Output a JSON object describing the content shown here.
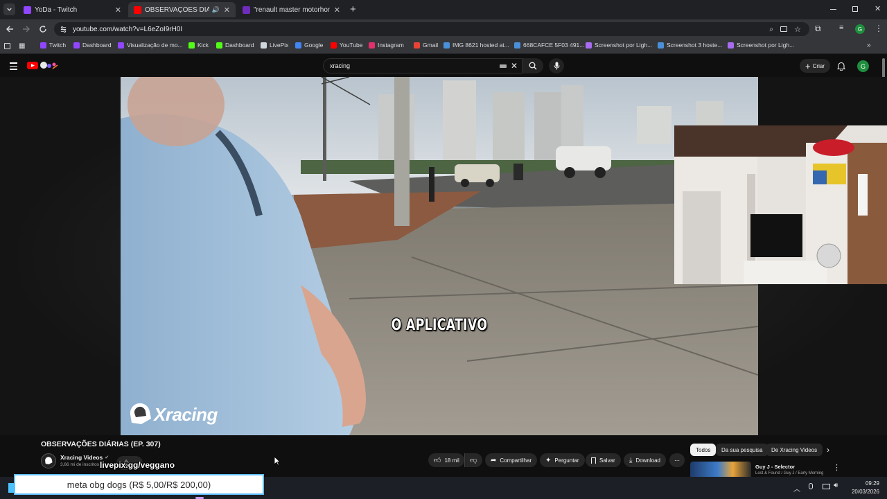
{
  "browser": {
    "tabs": [
      {
        "title": "YoDa - Twitch",
        "active": false,
        "favicon_color": "#9146ff"
      },
      {
        "title": "OBSERVAÇÕES DIÁRIAS (EP.",
        "active": true,
        "favicon_color": "#ff0000"
      },
      {
        "title": "\"renault master motorhome\" -",
        "active": false,
        "favicon_color": "#6f2dbd"
      }
    ],
    "new_tab_symbol": "+",
    "url": "youtube.com/watch?v=L6eZoI9rH0I",
    "bookmarks": [
      {
        "label": "Twitch",
        "color": "#9146ff"
      },
      {
        "label": "Dashboard",
        "color": "#9146ff"
      },
      {
        "label": "Visualização de mo...",
        "color": "#9146ff"
      },
      {
        "label": "Kick",
        "color": "#53fc18"
      },
      {
        "label": "Dashboard",
        "color": "#53fc18"
      },
      {
        "label": "LivePix",
        "color": "#cfd8dc"
      },
      {
        "label": "Google",
        "color": "#4285f4"
      },
      {
        "label": "YouTube",
        "color": "#ff0000"
      },
      {
        "label": "Instagram",
        "color": "#e1306c"
      },
      {
        "label": "Gmail",
        "color": "#ea4335"
      },
      {
        "label": "IMG 8621 hosted at...",
        "color": "#4a90d9"
      },
      {
        "label": "668CAFCE 5F03 491...",
        "color": "#4a90d9"
      },
      {
        "label": "Screenshot por Ligh...",
        "color": "#a86cf0"
      },
      {
        "label": "Screenshot 3 hoste...",
        "color": "#4a90d9"
      },
      {
        "label": "Screenshot por Ligh...",
        "color": "#a86cf0"
      }
    ],
    "profile_initial": "G"
  },
  "youtube": {
    "search_value": "xracing",
    "create_label": "Criar",
    "avatar_initial": "G",
    "video": {
      "subtitle": "O APLICATIVO",
      "watermark": "Xracing",
      "title": "OBSERVAÇÕES DIÁRIAS (EP. 307)",
      "channel": "Xracing Videos",
      "subscribers": "3,66 mi de inscritos",
      "likes": "18 mil",
      "share_label": "Compartilhar",
      "ask_label": "Perguntar",
      "save_label": "Salvar",
      "download_label": "Download"
    },
    "chips": [
      "Todos",
      "Da sua pesquisa",
      "De Xracing Videos"
    ],
    "recommendation": {
      "title": "Guy J - Selector",
      "subtitle": "Lost & Found / Guy J / Early Morning"
    }
  },
  "overlays": {
    "livepix_link": "livepix.gg/veggano",
    "goal_text": "meta obg dogs (R$ 5,00/R$ 200,00)"
  },
  "taskbar": {
    "time": "09:29",
    "date": "20/03/2026"
  }
}
